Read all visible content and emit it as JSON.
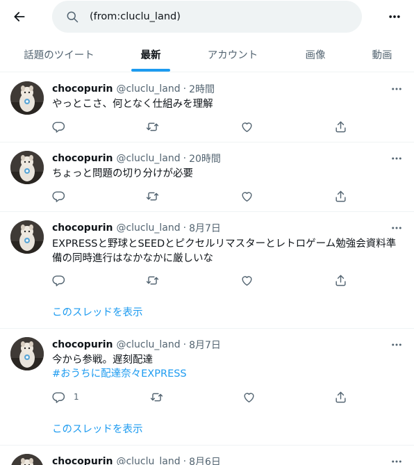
{
  "search": {
    "query": "(from:cluclu_land)"
  },
  "tabs": [
    {
      "label": "話題のツイート"
    },
    {
      "label": "最新"
    },
    {
      "label": "アカウント"
    },
    {
      "label": "画像"
    },
    {
      "label": "動画"
    }
  ],
  "active_tab": "最新",
  "colors": {
    "accent": "#1d9bf0",
    "text": "#0f1419",
    "muted": "#536471"
  },
  "tweets": [
    {
      "name": "chocopurin",
      "handle": "@cluclu_land",
      "sep": "·",
      "time": "2時間",
      "text": "やっとこさ、何となく仕組みを理解"
    },
    {
      "name": "chocopurin",
      "handle": "@cluclu_land",
      "sep": "·",
      "time": "20時間",
      "text": "ちょっと問題の切り分けが必要"
    },
    {
      "name": "chocopurin",
      "handle": "@cluclu_land",
      "sep": "·",
      "time": "8月7日",
      "text": "EXPRESSと野球とSEEDとピクセルリマスターとレトロゲーム勉強会資料準備の同時進行はなかなかに厳しいな",
      "thread_link": "このスレッドを表示"
    },
    {
      "name": "chocopurin",
      "handle": "@cluclu_land",
      "sep": "·",
      "time": "8月7日",
      "text": "今から参戦。遅刻配達",
      "hashtag": "#おうちに配達奈々EXPRESS",
      "reply_count": "1",
      "thread_link": "このスレッドを表示"
    },
    {
      "name": "chocopurin",
      "handle": "@cluclu_land",
      "sep": "·",
      "time": "8月6日"
    }
  ],
  "icons": [
    "back-arrow-icon",
    "search-icon",
    "more-icon",
    "reply-icon",
    "retweet-icon",
    "like-icon",
    "share-icon"
  ]
}
